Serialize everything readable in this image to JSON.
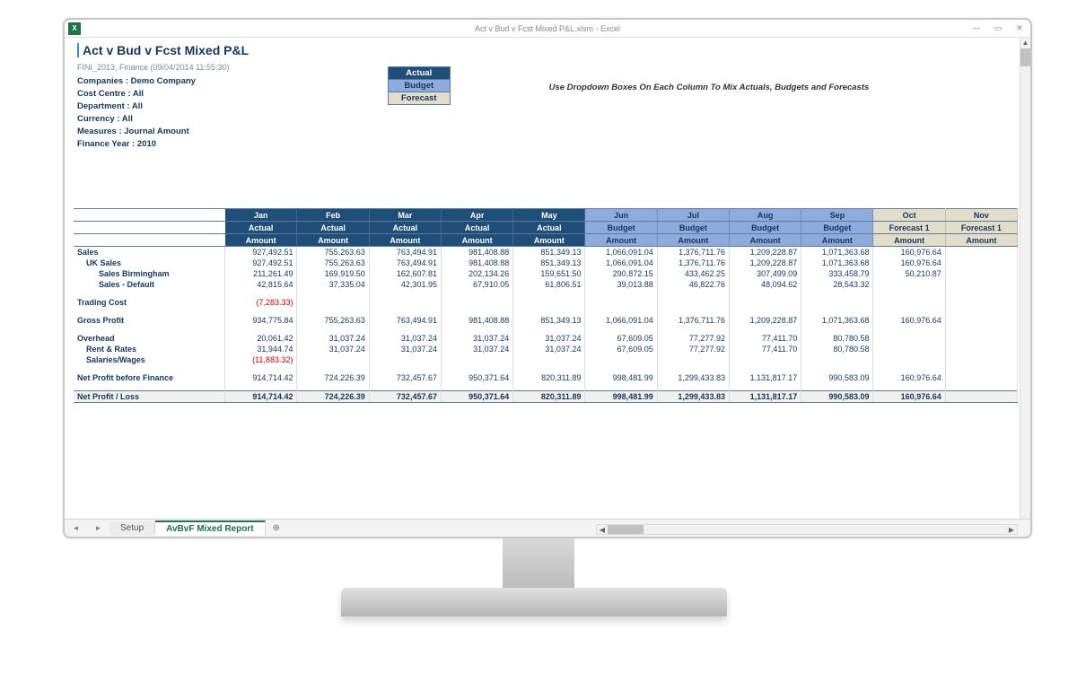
{
  "window": {
    "app_icon_label": "X",
    "title": "Act v Bud v Fcst Mixed P&L.xlsm - Excel",
    "min": "—",
    "max": "▭",
    "close": "✕"
  },
  "report": {
    "title": "Act v Bud v Fcst Mixed P&L",
    "subtitle": "FINI_2013, Finance (09/04/2014 11:55:30)",
    "meta": [
      "Companies : Demo Company",
      "Cost Centre : All",
      "Department : All",
      "Currency : All",
      "Measures : Journal Amount",
      "Finance Year : 2010"
    ]
  },
  "legend": {
    "actual": "Actual",
    "budget": "Budget",
    "forecast": "Forecast"
  },
  "instruction": "Use Dropdown Boxes On Each Column To Mix Actuals, Budgets and Forecasts",
  "columns": [
    {
      "month": "Jan",
      "type": "Actual",
      "sub": "Amount",
      "class": "actual"
    },
    {
      "month": "Feb",
      "type": "Actual",
      "sub": "Amount",
      "class": "actual"
    },
    {
      "month": "Mar",
      "type": "Actual",
      "sub": "Amount",
      "class": "actual"
    },
    {
      "month": "Apr",
      "type": "Actual",
      "sub": "Amount",
      "class": "actual"
    },
    {
      "month": "May",
      "type": "Actual",
      "sub": "Amount",
      "class": "actual"
    },
    {
      "month": "Jun",
      "type": "Budget",
      "sub": "Amount",
      "class": "budget"
    },
    {
      "month": "Jul",
      "type": "Budget",
      "sub": "Amount",
      "class": "budget"
    },
    {
      "month": "Aug",
      "type": "Budget",
      "sub": "Amount",
      "class": "budget"
    },
    {
      "month": "Sep",
      "type": "Budget",
      "sub": "Amount",
      "class": "budget"
    },
    {
      "month": "Oct",
      "type": "Forecast 1",
      "sub": "Amount",
      "class": "forecast"
    },
    {
      "month": "Nov",
      "type": "Forecast 1",
      "sub": "Amount",
      "class": "forecast"
    }
  ],
  "rows": [
    {
      "label": "Sales",
      "indent": 0,
      "vals": [
        "927,492.51",
        "755,263.63",
        "763,494.91",
        "981,408.88",
        "851,349.13",
        "1,066,091.04",
        "1,376,711.76",
        "1,209,228.87",
        "1,071,363.68",
        "160,976.64",
        ""
      ]
    },
    {
      "label": "UK Sales",
      "indent": 1,
      "vals": [
        "927,492.51",
        "755,263.63",
        "763,494.91",
        "981,408.88",
        "851,349.13",
        "1,066,091.04",
        "1,376,711.76",
        "1,209,228.87",
        "1,071,363.68",
        "160,976.64",
        ""
      ]
    },
    {
      "label": "Sales Birmingham",
      "indent": 2,
      "vals": [
        "211,261.49",
        "169,919.50",
        "162,607.81",
        "202,134.26",
        "159,651.50",
        "290,872.15",
        "433,462.25",
        "307,499.09",
        "333,458.79",
        "50,210.87",
        ""
      ]
    },
    {
      "label": "Sales - Default",
      "indent": 2,
      "vals": [
        "42,815.64",
        "37,335.04",
        "42,301.95",
        "67,910.05",
        "61,806.51",
        "39,013.88",
        "46,822.76",
        "48,094.62",
        "28,543.32",
        "",
        ""
      ]
    },
    {
      "spacer": true
    },
    {
      "label": "Trading Cost",
      "indent": 0,
      "vals": [
        "(7,283.33)",
        "",
        "",
        "",
        "",
        "",
        "",
        "",
        "",
        "",
        ""
      ],
      "neg": [
        0
      ]
    },
    {
      "spacer": true
    },
    {
      "label": "Gross Profit",
      "indent": 0,
      "vals": [
        "934,775.84",
        "755,263.63",
        "763,494.91",
        "981,408.88",
        "851,349.13",
        "1,066,091.04",
        "1,376,711.76",
        "1,209,228.87",
        "1,071,363.68",
        "160,976.64",
        ""
      ]
    },
    {
      "spacer": true
    },
    {
      "label": "Overhead",
      "indent": 0,
      "vals": [
        "20,061.42",
        "31,037.24",
        "31,037.24",
        "31,037.24",
        "31,037.24",
        "67,609.05",
        "77,277.92",
        "77,411.70",
        "80,780.58",
        "",
        ""
      ]
    },
    {
      "label": "Rent & Rates",
      "indent": 1,
      "vals": [
        "31,944.74",
        "31,037.24",
        "31,037.24",
        "31,037.24",
        "31,037.24",
        "67,609.05",
        "77,277.92",
        "77,411.70",
        "80,780.58",
        "",
        ""
      ]
    },
    {
      "label": "Salaries/Wages",
      "indent": 1,
      "vals": [
        "(11,883.32)",
        "",
        "",
        "",
        "",
        "",
        "",
        "",
        "",
        "",
        ""
      ],
      "neg": [
        0
      ]
    },
    {
      "spacer": true
    },
    {
      "label": "Net Profit before Finance",
      "indent": 0,
      "vals": [
        "914,714.42",
        "724,226.39",
        "732,457.67",
        "950,371.64",
        "820,311.89",
        "998,481.99",
        "1,299,433.83",
        "1,131,817.17",
        "990,583.09",
        "160,976.64",
        ""
      ]
    },
    {
      "spacer": true
    },
    {
      "label": "Net Profit / Loss",
      "indent": 0,
      "netloss": true,
      "vals": [
        "914,714.42",
        "724,226.39",
        "732,457.67",
        "950,371.64",
        "820,311.89",
        "998,481.99",
        "1,299,433.83",
        "1,131,817.17",
        "990,583.09",
        "160,976.64",
        ""
      ]
    }
  ],
  "tabs": {
    "setup": "Setup",
    "active": "AvBvF Mixed Report",
    "add": "⊕"
  },
  "tabnav": {
    "first": "◄",
    "prev": "‹",
    "next": "›",
    "last": "►"
  }
}
